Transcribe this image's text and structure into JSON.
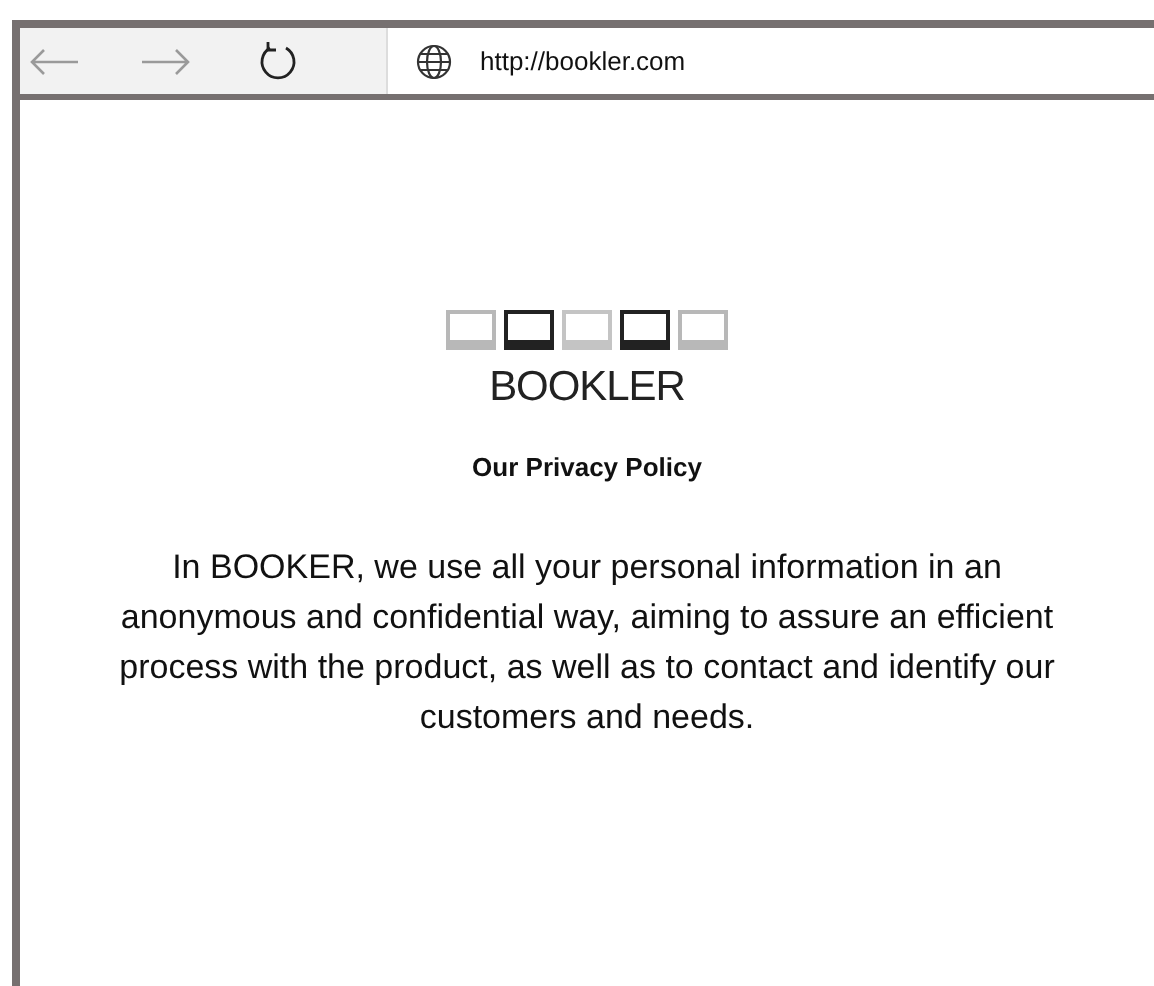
{
  "browser": {
    "url": "http://bookler.com"
  },
  "logo": {
    "wordmark": "BOOKLER"
  },
  "heading": "Our Privacy Policy",
  "body": "In BOOKER, we use all your personal information in an anonymous and confidential way, aiming to assure an efficient process with the product, as well as to contact and identify our customers and needs."
}
